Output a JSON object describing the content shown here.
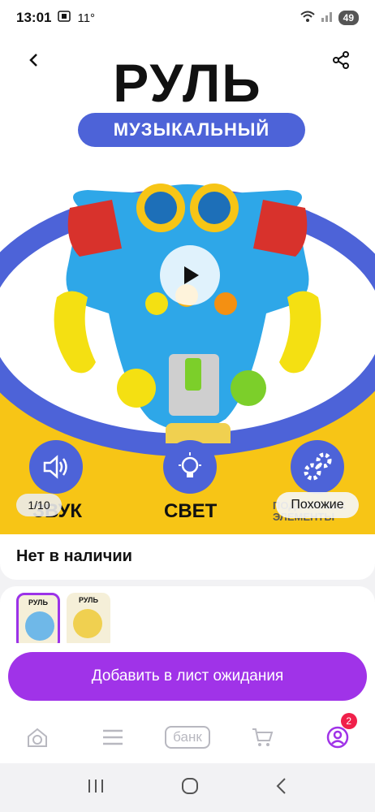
{
  "status": {
    "time": "13:01",
    "temp": "11°",
    "battery": "49"
  },
  "hero": {
    "title": "РУЛЬ",
    "subtitle": "МУЗЫКАЛЬНЫЙ",
    "features": [
      {
        "label": "ЗВУК",
        "icon": "speaker-icon"
      },
      {
        "label": "СВЕТ",
        "icon": "bulb-icon"
      },
      {
        "label": "ПОДВИЖНЫЕ ЭЛЕМЕНТЫ",
        "icon": "gears-icon"
      }
    ],
    "counter": "1/10",
    "similar_label": "Похожие"
  },
  "stock": {
    "label": "Нет в наличии"
  },
  "thumbs": [
    {
      "title": "РУЛЬ"
    },
    {
      "title": "РУЛЬ"
    }
  ],
  "actions": {
    "add_waitlist": "Добавить в лист ожидания"
  },
  "tabbar": {
    "bank_label": "банк",
    "badge_count": "2"
  },
  "colors": {
    "accent": "#a033e8",
    "hero_blue": "#4d63d8",
    "hero_yellow": "#f7c516",
    "badge": "#f0204a"
  }
}
